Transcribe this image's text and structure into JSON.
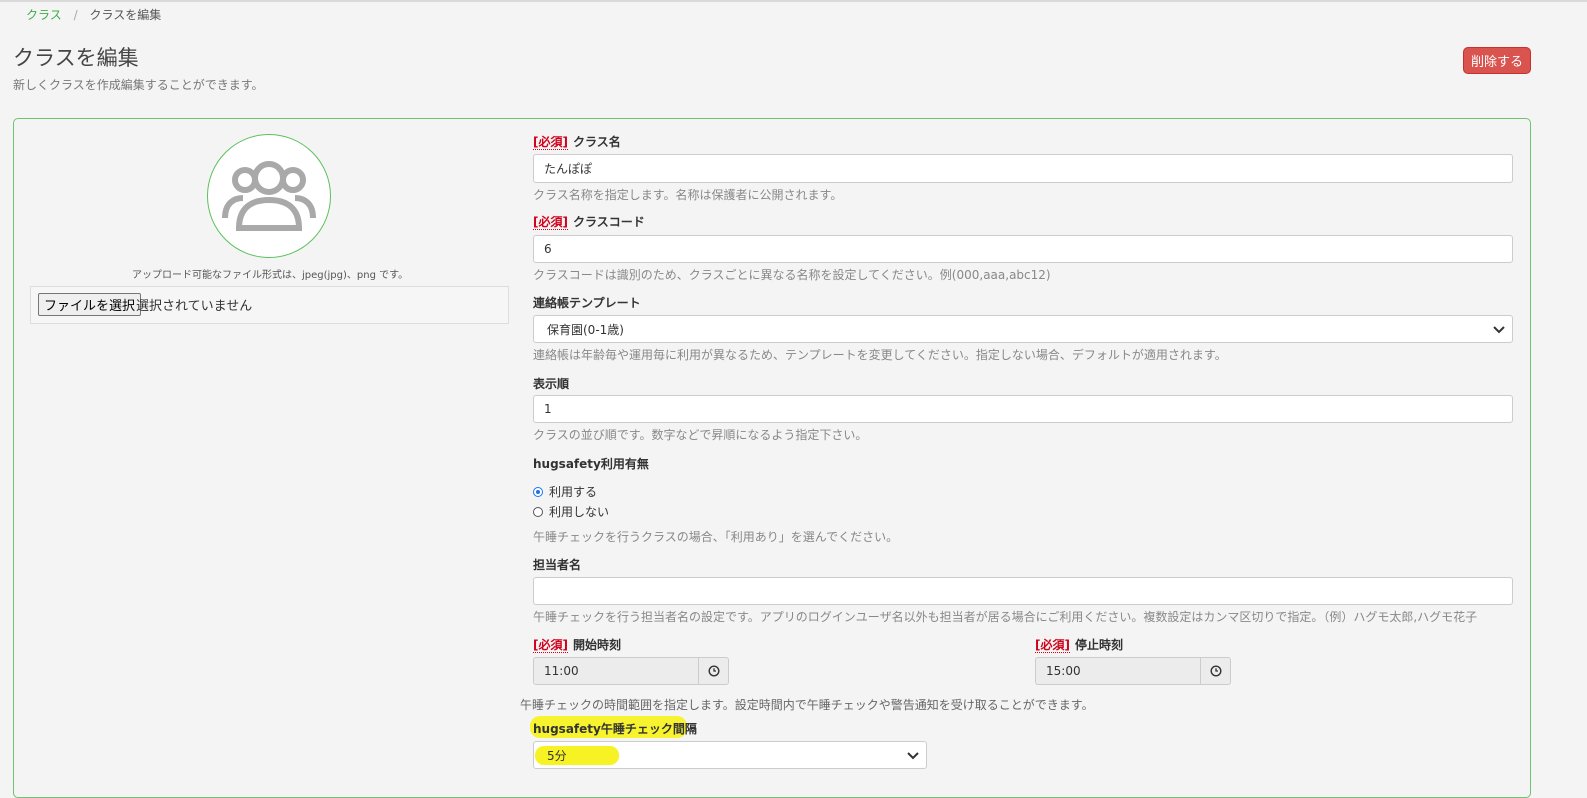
{
  "breadcrumb": {
    "root": "クラス",
    "separator": "/",
    "current": "クラスを編集"
  },
  "header": {
    "title": "クラスを編集",
    "subtitle": "新しくクラスを作成編集することができます。",
    "delete_label": "削除する"
  },
  "upload": {
    "note": "アップロード可能なファイル形式は、jpeg(jpg)、png です。",
    "button_label": "ファイルを選択",
    "status": "選択されていません"
  },
  "form": {
    "required_tag": "[必須]",
    "class_name": {
      "label": "クラス名",
      "value": "たんぽぽ",
      "help": "クラス名称を指定します。名称は保護者に公開されます。"
    },
    "class_code": {
      "label": "クラスコード",
      "value": "6",
      "help": "クラスコードは識別のため、クラスごとに異なる名称を設定してください。例(000,aaa,abc12)"
    },
    "template": {
      "label": "連絡帳テンプレート",
      "value": "保育園(0-1歳)",
      "help": "連絡帳は年齢毎や運用毎に利用が異なるため、テンプレートを変更してください。指定しない場合、デフォルトが適用されます。"
    },
    "order": {
      "label": "表示順",
      "value": "1",
      "help": "クラスの並び順です。数字などで昇順になるよう指定下さい。"
    },
    "hugsafety": {
      "label": "hugsafety利用有無",
      "options": [
        {
          "label": "利用する",
          "selected": true
        },
        {
          "label": "利用しない",
          "selected": false
        }
      ],
      "help": "午睡チェックを行うクラスの場合、「利用あり」を選んでください。"
    },
    "staff": {
      "label": "担当者名",
      "value": "",
      "help": "午睡チェックを行う担当者名の設定です。アプリのログインユーザ名以外も担当者が居る場合にご利用ください。複数設定はカンマ区切りで指定。（例）ハグモ太郎,ハグモ花子"
    },
    "start_time": {
      "label": "開始時刻",
      "value": "11:00"
    },
    "stop_time": {
      "label": "停止時刻",
      "value": "15:00"
    },
    "time_help": "午睡チェックの時間範囲を指定します。設定時間内で午睡チェックや警告通知を受け取ることができます。",
    "interval": {
      "label": "hugsafety午睡チェック間隔",
      "value": "5分"
    }
  },
  "colors": {
    "accent": "#3bab4a",
    "danger": "#d9534f",
    "required": "#d0021b",
    "highlight": "#f7f224"
  },
  "icons": {
    "avatar": "group-avatar-icon",
    "clock": "clock-icon",
    "chevron": "chevron-down-icon"
  }
}
